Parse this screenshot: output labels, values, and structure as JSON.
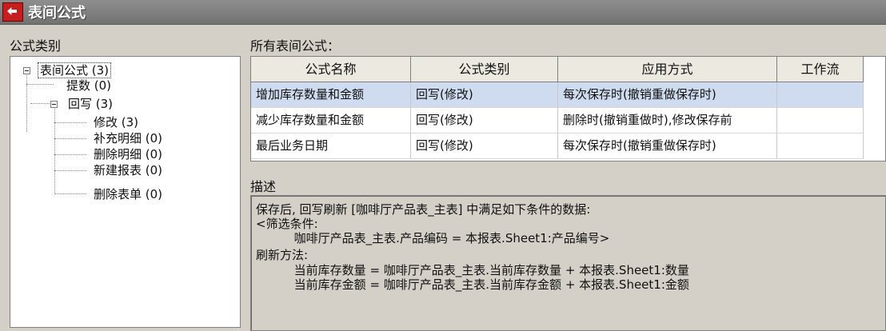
{
  "window": {
    "title": "表间公式"
  },
  "left": {
    "label": "公式类别",
    "tree": [
      {
        "label": "表间公式 (3)"
      },
      {
        "label": "提数 (0)"
      },
      {
        "label": "回写 (3)"
      },
      {
        "label": "修改 (3)"
      },
      {
        "label": "补充明细 (0)"
      },
      {
        "label": "删除明细 (0)"
      },
      {
        "label": "新建报表 (0)"
      },
      {
        "label": "删除表单 (0)"
      }
    ]
  },
  "right": {
    "label": "所有表间公式：",
    "columns": [
      "公式名称",
      "公式类别",
      "应用方式",
      "工作流"
    ],
    "rows": [
      {
        "name": "增加库存数量和金额",
        "category": "回写(修改)",
        "mode": "每次保存时(撤销重做保存时)",
        "workflow": ""
      },
      {
        "name": "减少库存数量和金额",
        "category": "回写(修改)",
        "mode": "删除时(撤销重做时),修改保存前",
        "workflow": ""
      },
      {
        "name": "最后业务日期",
        "category": "回写(修改)",
        "mode": "每次保存时(撤销重做保存时)",
        "workflow": ""
      }
    ],
    "description": {
      "label": "描述",
      "lines": [
        "保存后, 回写刷新 [咖啡厅产品表_主表] 中满足如下条件的数据:",
        "<筛选条件:",
        "          咖啡厅产品表_主表.产品编码 = 本报表.Sheet1:产品编号>",
        "刷新方法:",
        "          当前库存数量 = 咖啡厅产品表_主表.当前库存数量 + 本报表.Sheet1:数量",
        "          当前库存金额 = 咖啡厅产品表_主表.当前库存金额 + 本报表.Sheet1:金额"
      ]
    }
  }
}
